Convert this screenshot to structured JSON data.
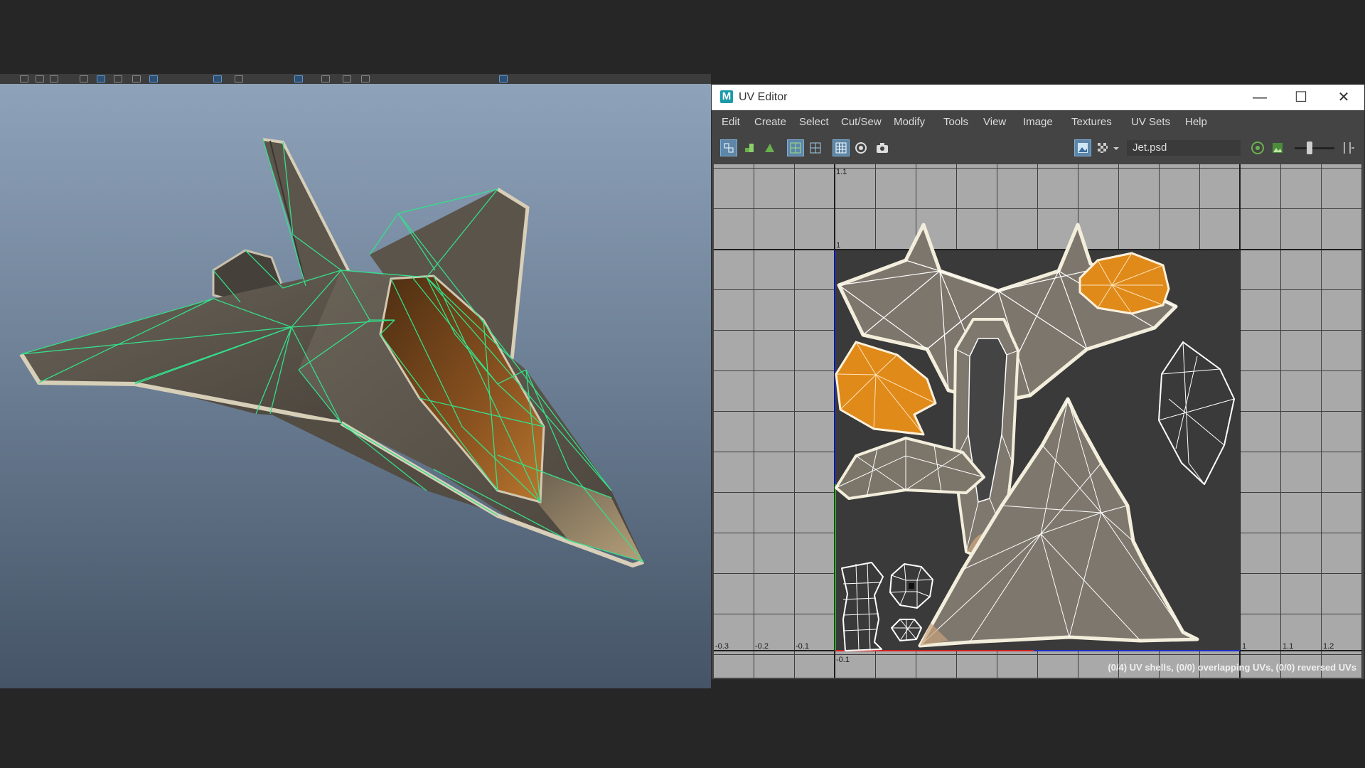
{
  "uv_editor": {
    "title": "UV Editor",
    "logo_letter": "M",
    "window_controls": [
      "—",
      "☐",
      "✕"
    ],
    "menu": [
      "Edit",
      "Create",
      "Select",
      "Cut/Sew",
      "Modify",
      "Tools",
      "View",
      "Image",
      "Textures",
      "UV Sets",
      "Help"
    ],
    "texture_file": "Jet.psd",
    "axis_labels": {
      "x": [
        "-0.3",
        "-0.2",
        "-0.1",
        "1",
        "1.1",
        "1.2"
      ],
      "y": [
        "1.1",
        "1",
        "-0.1"
      ]
    },
    "status": "(0/4) UV shells, (0/0) overlapping UVs, (0/0) reversed UVs",
    "colors": {
      "grid_bg": "#a9a9a9",
      "texture_bg": "#3c3c3c",
      "shell_fill": "#8f8679",
      "selected_shell": "#e08a1a",
      "wire": "#ffffff"
    }
  },
  "viewport": {
    "wireframe_color": "#33e08a",
    "hull_color": "#5a5349",
    "cockpit_color": "#9a5a1c"
  },
  "icons": {
    "toolbar": [
      "uv-shell-icon",
      "uv-snapshot-icon",
      "uv-move-icon",
      "grid-toggle-icon",
      "grid-icon",
      "checker-icon",
      "pin-icon",
      "camera-icon",
      "image-display-icon",
      "checker-pattern-icon",
      "dropdown-icon",
      "texture-icon",
      "image-icon"
    ]
  }
}
